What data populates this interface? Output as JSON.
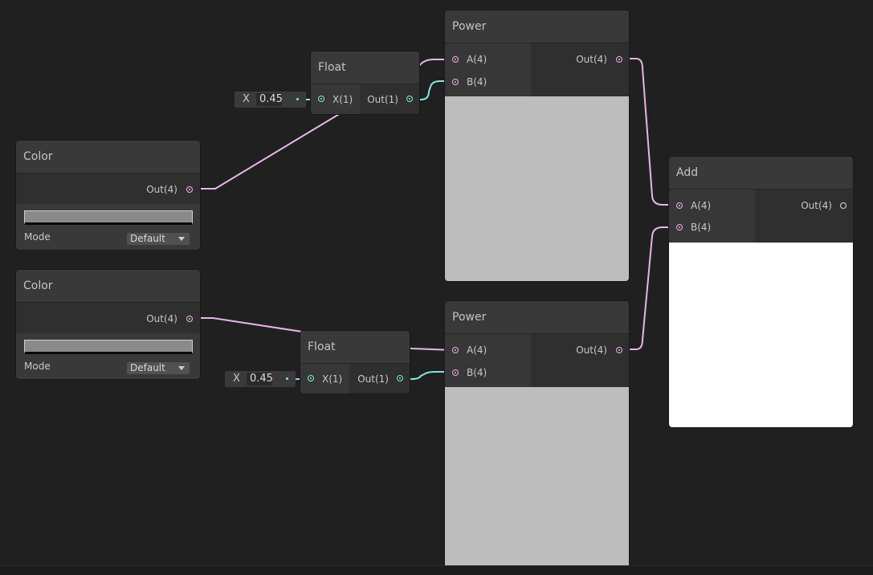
{
  "colors": {
    "wire_vector": "#e8b4e8",
    "wire_float": "#7fe8e0",
    "background": "#202020"
  },
  "nodes": {
    "power_top": {
      "title": "Power",
      "in_a": "A(4)",
      "in_b": "B(4)",
      "out": "Out(4)"
    },
    "power_bottom": {
      "title": "Power",
      "in_a": "A(4)",
      "in_b": "B(4)",
      "out": "Out(4)"
    },
    "float_top": {
      "title": "Float",
      "in_x": "X(1)",
      "out": "Out(1)",
      "field_label": "X",
      "field_value": "0.45"
    },
    "float_bottom": {
      "title": "Float",
      "in_x": "X(1)",
      "out": "Out(1)",
      "field_label": "X",
      "field_value": "0.45"
    },
    "color_top": {
      "title": "Color",
      "out": "Out(4)",
      "mode_label": "Mode",
      "mode_value": "Default",
      "swatch": "#8a8a8a"
    },
    "color_bottom": {
      "title": "Color",
      "out": "Out(4)",
      "mode_label": "Mode",
      "mode_value": "Default",
      "swatch": "#8a8a8a"
    },
    "add": {
      "title": "Add",
      "in_a": "A(4)",
      "in_b": "B(4)",
      "out": "Out(4)"
    }
  }
}
